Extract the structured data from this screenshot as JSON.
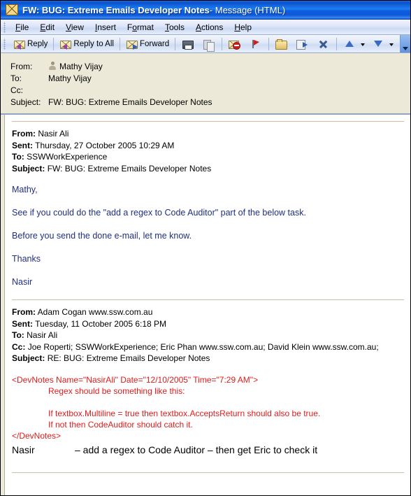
{
  "window": {
    "title_main": "FW: BUG: Extreme Emails Developer Notes",
    "title_suffix": " - Message (HTML)",
    "title_icon": "envelope-icon"
  },
  "menubar": {
    "items": [
      {
        "label": "File",
        "accel": "F"
      },
      {
        "label": "Edit",
        "accel": "E"
      },
      {
        "label": "View",
        "accel": "V"
      },
      {
        "label": "Insert",
        "accel": "I"
      },
      {
        "label": "Format",
        "accel": "o"
      },
      {
        "label": "Tools",
        "accel": "T"
      },
      {
        "label": "Actions",
        "accel": "A"
      },
      {
        "label": "Help",
        "accel": "H"
      }
    ]
  },
  "toolbar": {
    "reply_label": "Reply",
    "reply_all_label": "Reply to All",
    "forward_label": "Forward",
    "icons": [
      "reply-icon",
      "reply-all-icon",
      "forward-icon",
      "print-icon",
      "copy-icon",
      "delete-icon",
      "flag-icon",
      "open-folder-icon",
      "move-to-folder-icon",
      "delete-x-icon",
      "previous-item-icon",
      "previous-dropdown-icon",
      "next-item-icon",
      "next-dropdown-icon",
      "font-size-icon",
      "find-icon",
      "help-icon",
      "toolbar-overflow-icon"
    ]
  },
  "envelope": {
    "rows": [
      {
        "label": "From:",
        "value": "Mathy Vijay",
        "has_person_icon": true
      },
      {
        "label": "To:",
        "value": "Mathy Vijay",
        "has_person_icon": false
      },
      {
        "label": "Cc:",
        "value": "",
        "has_person_icon": false
      },
      {
        "label": "Subject:",
        "value": "FW: BUG: Extreme Emails Developer Notes",
        "has_person_icon": false
      }
    ]
  },
  "message": {
    "forwarded_header": [
      {
        "label": "From:",
        "value": "Nasir Ali"
      },
      {
        "label": "Sent:",
        "value": "Thursday, 27 October 2005 10:29 AM"
      },
      {
        "label": "To:",
        "value": "SSWWorkExperience"
      },
      {
        "label": "Subject:",
        "value": "FW: BUG: Extreme Emails Developer Notes"
      }
    ],
    "body_paragraphs": [
      "Mathy,",
      "See if you could do the \"add a regex to Code Auditor\" part of the below task.",
      "Before you send the done e-mail, let me know.",
      "Thanks",
      "Nasir"
    ],
    "original_header": [
      {
        "label": "From:",
        "value": "Adam Cogan www.ssw.com.au"
      },
      {
        "label": "Sent:",
        "value": "Tuesday, 11 October 2005 6:18 PM"
      },
      {
        "label": "To:",
        "value": "Nasir Ali"
      },
      {
        "label": "Cc:",
        "value": "Joe Roperti; SSWWorkExperience; Eric Phan www.ssw.com.au; David Klein www.ssw.com.au;"
      },
      {
        "label": "Subject:",
        "value": "RE: BUG: Extreme Emails Developer Notes"
      }
    ],
    "devnotes": {
      "open_tag": "<DevNotes Name=\"NasirAli\" Date=\"12/10/2005\" Time=\"7:29 AM\">",
      "line1": "Regex should be something like this:",
      "line2": "If textbox.Multiline = true then textbox.AcceptsReturn should also be true.",
      "line3": "If not then CodeAuditor should catch it.",
      "close_tag": "</DevNotes>"
    },
    "final_line": {
      "name": "Nasir",
      "task": "– add a regex to Code Auditor – then get Eric to check it"
    }
  },
  "colors": {
    "title_blue": "#0a52cf",
    "quote_blue": "#1f2f80",
    "devnotes_red": "#e01b1b",
    "window_face": "#ece9d8"
  }
}
